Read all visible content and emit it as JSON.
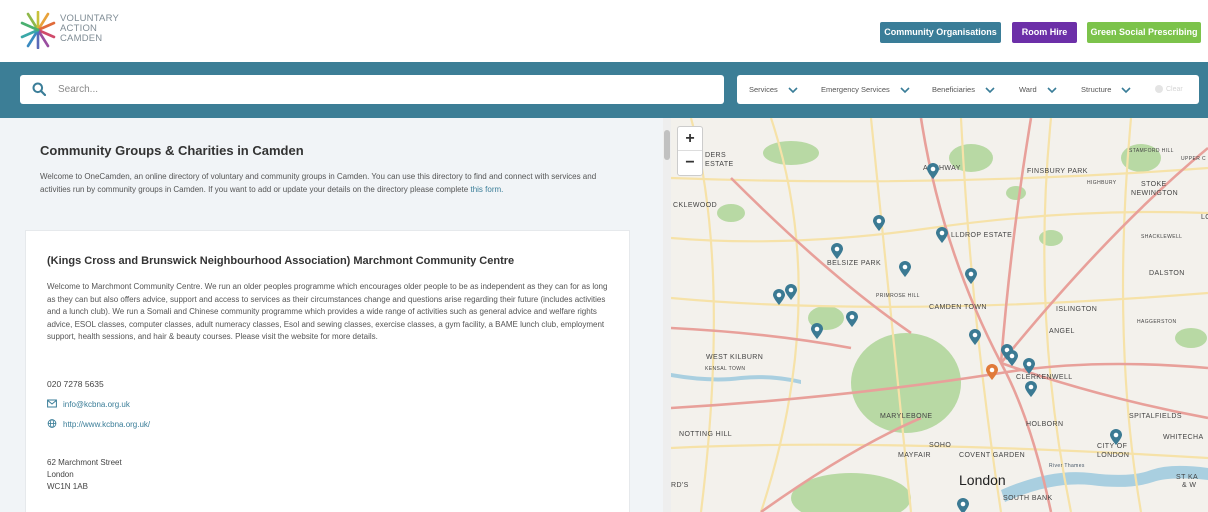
{
  "header": {
    "logo": {
      "line1": "VOLUNTARY",
      "line2": "ACTION",
      "line3": "CAMDEN"
    },
    "buttons": {
      "community": "Community Organisations",
      "room": "Room Hire",
      "green": "Green Social Prescribing"
    },
    "colors": {
      "community": "#3a7d98",
      "room": "#6c2fa8",
      "green": "#7cc34b",
      "band": "#3c7e96"
    }
  },
  "search": {
    "placeholder": "Search..."
  },
  "filters": {
    "services": "Services",
    "emergency": "Emergency Services",
    "beneficiaries": "Beneficiaries",
    "ward": "Ward",
    "structure": "Structure",
    "clear": "Clear"
  },
  "main": {
    "title": "Community Groups & Charities in Camden",
    "intro_text": "Welcome to OneCamden, an online directory of voluntary and community groups in Camden. You can use this directory to find and connect with services and activities run by community groups in Camden. If you want to add or update your details on the directory please complete",
    "intro_link": "this form."
  },
  "listing": {
    "title": "(Kings Cross and Brunswick Neighbourhood Association) Marchmont Community Centre",
    "description": "Welcome to Marchmont Community Centre. We run an older peoples programme which encourages older people to be as independent as they can for as long as they can but also offers advice, support and access to services as their circumstances change and questions arise regarding their future (includes activities and a lunch club). We run a Somali and Chinese community programme which provides a wide range of activities such as general advice and welfare rights advice, ESOL classes, computer classes, adult numeracy classes, Esol and sewing classes, exercise classes, a gym facility, a BAME lunch club, employment support, health sessions, and hair & beauty courses. Please visit the website for more details.",
    "phone": "020 7278 5635",
    "email": "info@kcbna.org.uk",
    "website": "http://www.kcbna.org.uk/",
    "address": {
      "line1": "62 Marchmont Street",
      "line2": "London",
      "line3": "WC1N 1AB"
    }
  },
  "map": {
    "zoom_in": "+",
    "zoom_out": "−",
    "labels": {
      "ders_estate_1": "DERS",
      "ders_estate_2": "ESTATE",
      "archway": "ARCHWAY",
      "finsbury_park": "FINSBURY PARK",
      "stroud_green": "STROUD GREEN",
      "stamford_hill": "STAMFORD HILL",
      "upper": "UPPER C",
      "stoke_newington_1": "STOKE",
      "stoke_newington_2": "NEWINGTON",
      "highbury": "HIGHBURY",
      "cricklewood": "CKLEWOOD",
      "ldrop_estate": "LLDROP ESTATE",
      "belsize_park": "BELSIZE PARK",
      "shacklewell": "SHACKLEWELL",
      "dalston": "DALSTON",
      "primrose_hill": "PRIMROSE HILL",
      "camden_town": "CAMDEN TOWN",
      "islington": "ISLINGTON",
      "haggerston": "HAGGERSTON",
      "angel": "ANGEL",
      "west_kilburn": "WEST KILBURN",
      "kensal_town": "KENSAL TOWN",
      "clerkenwell": "CLERKENWELL",
      "marylebone": "MARYLEBONE",
      "spitalfields": "SPITALFIELDS",
      "notting_hill": "NOTTING HILL",
      "holborn": "HOLBORN",
      "whitechapel": "WHITECHA",
      "soho": "SOHO",
      "city_of_london_1": "CITY OF",
      "city_of_london_2": "LONDON",
      "mayfair": "MAYFAIR",
      "covent_garden": "COVENT GARDEN",
      "river_thames": "River Thames",
      "london": "London",
      "st_ka_1": "ST KA",
      "st_ka_2": "& W",
      "south_bank": "SOUTH BANK",
      "rds": "RD'S",
      "lo": "LO"
    },
    "colors": {
      "pin": "#3b7a93",
      "pin_active": "#e07a3a",
      "park": "#b8d9a4",
      "road_major": "#e8a09a",
      "road_minor": "#f6e2a8",
      "water": "#a9cfe0"
    }
  }
}
